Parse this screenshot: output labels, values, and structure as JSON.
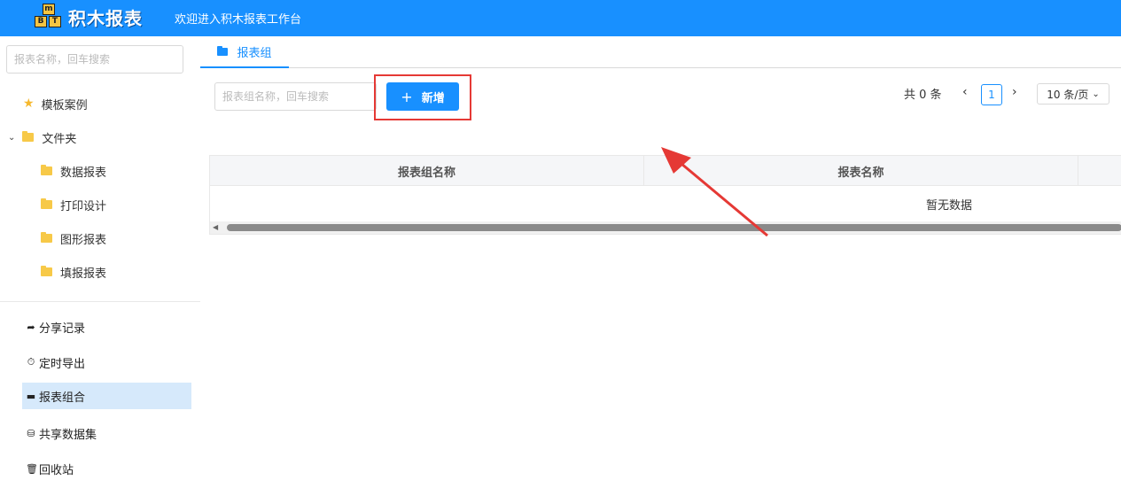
{
  "header": {
    "logo_letters": [
      "m",
      "B",
      "T"
    ],
    "logo_text": "积木报表",
    "welcome": "欢迎进入积木报表工作台"
  },
  "sidebar": {
    "search_placeholder": "报表名称，回车搜索",
    "tree": {
      "templates_label": "模板案例",
      "folder_label": "文件夹",
      "children": [
        "数据报表",
        "打印设计",
        "图形报表",
        "填报报表"
      ]
    },
    "menu": [
      {
        "label": "分享记录",
        "icon": "share-icon"
      },
      {
        "label": "定时导出",
        "icon": "clock-icon"
      },
      {
        "label": "报表组合",
        "icon": "folder-icon",
        "active": true
      },
      {
        "label": "共享数据集",
        "icon": "database-icon"
      },
      {
        "label": "回收站",
        "icon": "trash-icon"
      }
    ]
  },
  "main": {
    "tab_label": "报表组",
    "group_search_placeholder": "报表组名称，回车搜索",
    "add_button_label": "新增",
    "pagination": {
      "total_text": "共 0 条",
      "current_page": "1",
      "page_size": "10 条/页"
    },
    "table": {
      "columns": [
        "报表组名称",
        "报表名称"
      ],
      "empty_text": "暂无数据"
    }
  },
  "colors": {
    "primary": "#1890ff",
    "highlight": "#e53935",
    "folder": "#f7c948"
  }
}
